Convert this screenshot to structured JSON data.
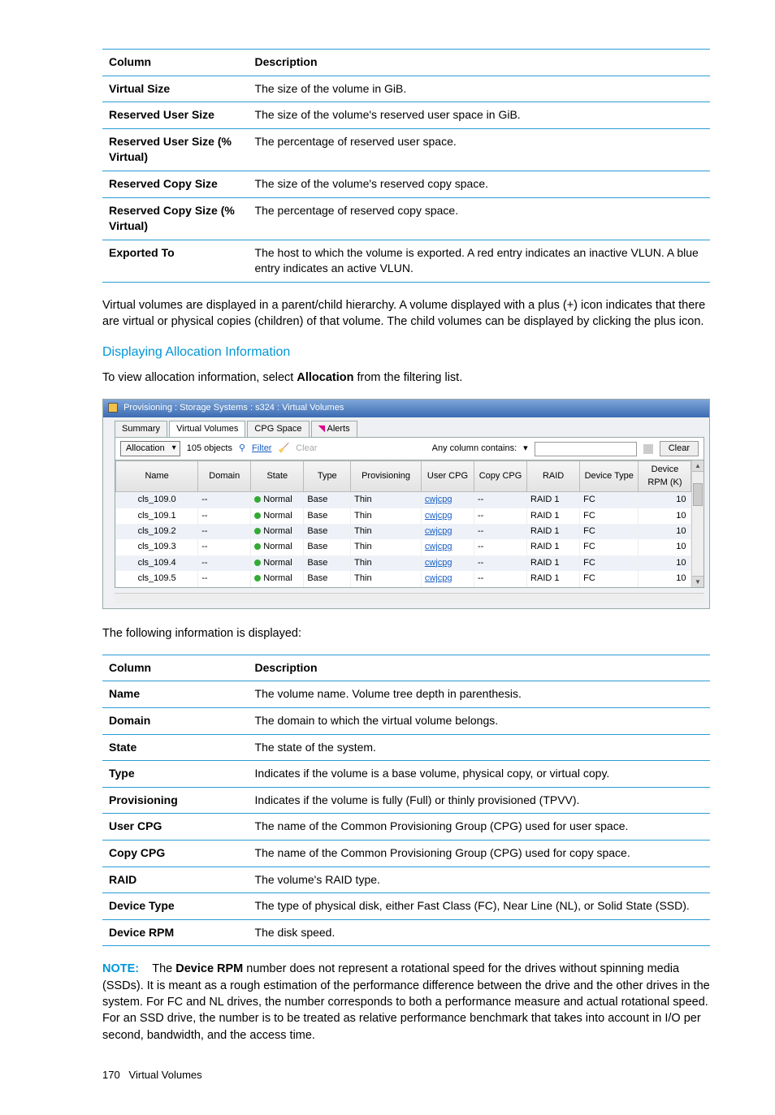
{
  "table1": {
    "headers": [
      "Column",
      "Description"
    ],
    "rows": [
      [
        "Virtual Size",
        "The size of the volume in GiB."
      ],
      [
        "Reserved User Size",
        "The size of the volume's reserved user space in GiB."
      ],
      [
        "Reserved User Size (% Virtual)",
        "The percentage of reserved user space."
      ],
      [
        "Reserved Copy Size",
        "The size of the volume's reserved copy space."
      ],
      [
        "Reserved Copy Size (% Virtual)",
        "The percentage of reserved copy space."
      ],
      [
        "Exported To",
        "The host to which the volume is exported. A red entry indicates an inactive VLUN. A blue entry indicates an active VLUN."
      ]
    ]
  },
  "para1": "Virtual volumes are displayed in a parent/child hierarchy. A volume displayed with a plus (+) icon indicates that there are virtual or physical copies (children) of that volume. The child volumes can be displayed by clicking the plus icon.",
  "section_heading": "Displaying Allocation Information",
  "para2_pre": "To view allocation information, select ",
  "para2_bold": "Allocation",
  "para2_post": " from the filtering list.",
  "app": {
    "title": "Provisioning : Storage Systems : s324 : Virtual Volumes",
    "tabs": [
      "Summary",
      "Virtual Volumes",
      "CPG Space",
      "Alerts"
    ],
    "toolbar": {
      "dropdown": "Allocation",
      "count": "105 objects",
      "filter": "Filter",
      "clear1": "Clear",
      "anycol": "Any column contains:",
      "clear2": "Clear"
    },
    "columns": [
      "Name",
      "Domain",
      "State",
      "Type",
      "Provisioning",
      "User CPG",
      "Copy CPG",
      "RAID",
      "Device Type",
      "Device RPM (K)"
    ],
    "rows": [
      {
        "name": "cls_109.0",
        "domain": "--",
        "state": "Normal",
        "type": "Base",
        "prov": "Thin",
        "ucpg": "cwjcpg",
        "ccpg": "--",
        "raid": "RAID 1",
        "dtype": "FC",
        "rpm": "10"
      },
      {
        "name": "cls_109.1",
        "domain": "--",
        "state": "Normal",
        "type": "Base",
        "prov": "Thin",
        "ucpg": "cwjcpg",
        "ccpg": "--",
        "raid": "RAID 1",
        "dtype": "FC",
        "rpm": "10"
      },
      {
        "name": "cls_109.2",
        "domain": "--",
        "state": "Normal",
        "type": "Base",
        "prov": "Thin",
        "ucpg": "cwjcpg",
        "ccpg": "--",
        "raid": "RAID 1",
        "dtype": "FC",
        "rpm": "10"
      },
      {
        "name": "cls_109.3",
        "domain": "--",
        "state": "Normal",
        "type": "Base",
        "prov": "Thin",
        "ucpg": "cwjcpg",
        "ccpg": "--",
        "raid": "RAID 1",
        "dtype": "FC",
        "rpm": "10"
      },
      {
        "name": "cls_109.4",
        "domain": "--",
        "state": "Normal",
        "type": "Base",
        "prov": "Thin",
        "ucpg": "cwjcpg",
        "ccpg": "--",
        "raid": "RAID 1",
        "dtype": "FC",
        "rpm": "10"
      },
      {
        "name": "cls_109.5",
        "domain": "--",
        "state": "Normal",
        "type": "Base",
        "prov": "Thin",
        "ucpg": "cwjcpg",
        "ccpg": "--",
        "raid": "RAID 1",
        "dtype": "FC",
        "rpm": "10"
      }
    ]
  },
  "para3": "The following information is displayed:",
  "table2": {
    "headers": [
      "Column",
      "Description"
    ],
    "rows": [
      [
        "Name",
        "The volume name. Volume tree depth in parenthesis."
      ],
      [
        "Domain",
        "The domain to which the virtual volume belongs."
      ],
      [
        "State",
        "The state of the system."
      ],
      [
        "Type",
        "Indicates if the volume is a base volume, physical copy, or virtual copy."
      ],
      [
        "Provisioning",
        "Indicates if the volume is fully (Full) or thinly provisioned (TPVV)."
      ],
      [
        "User CPG",
        "The name of the Common Provisioning Group (CPG) used for user space."
      ],
      [
        "Copy CPG",
        "The name of the Common Provisioning Group (CPG) used for copy space."
      ],
      [
        "RAID",
        "The volume's RAID type."
      ],
      [
        "Device Type",
        "The type of physical disk, either Fast Class (FC), Near Line (NL), or Solid State (SSD)."
      ],
      [
        "Device RPM",
        "The disk speed."
      ]
    ]
  },
  "note": {
    "label": "NOTE:",
    "pre": "The ",
    "bold": "Device RPM",
    "post": " number does not represent a rotational speed for the drives without spinning media (SSDs). It is meant as a rough estimation of the performance difference between the drive and the other drives in the system. For FC and NL drives, the number corresponds to both a performance measure and actual rotational speed. For an SSD drive, the number is to be treated as relative performance benchmark that takes into account in I/O per second, bandwidth, and the access time."
  },
  "footer": {
    "page": "170",
    "section": "Virtual Volumes"
  }
}
